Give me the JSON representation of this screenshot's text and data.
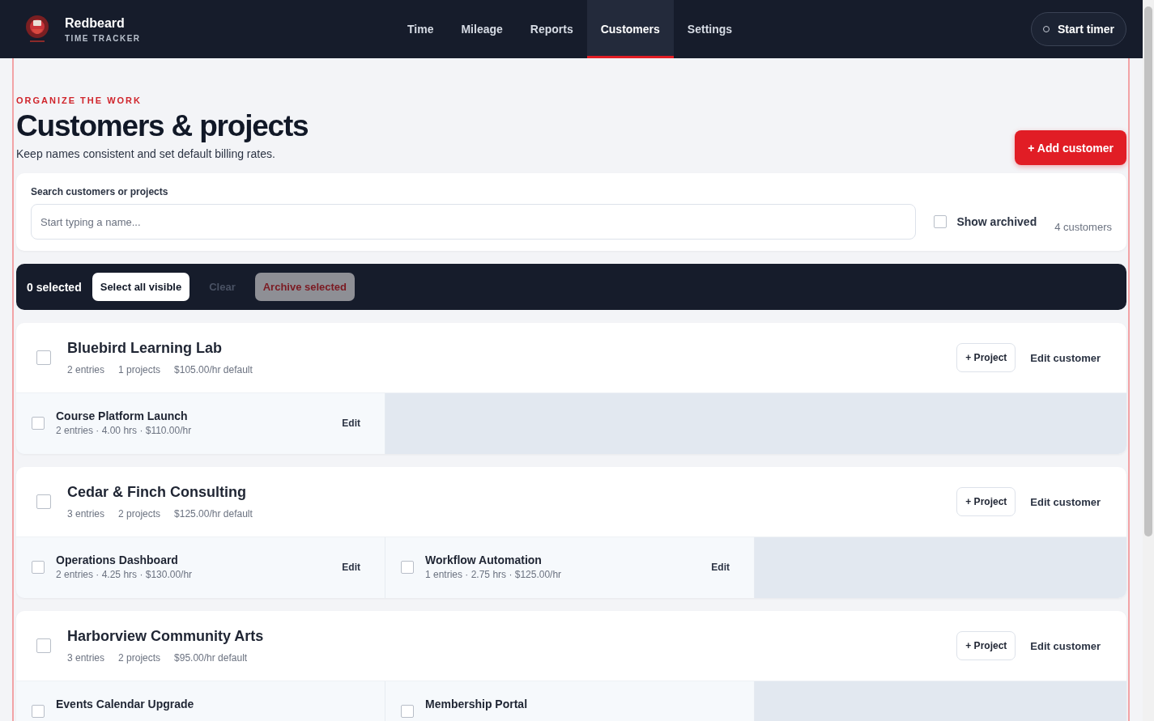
{
  "nav": {
    "brand": "Redbeard",
    "tagline": "TIME TRACKER",
    "tabs": [
      {
        "label": "Time",
        "selected": false
      },
      {
        "label": "Mileage",
        "selected": false
      },
      {
        "label": "Reports",
        "selected": false
      },
      {
        "label": "Customers",
        "selected": true
      },
      {
        "label": "Settings",
        "selected": false
      }
    ],
    "timer_button": "Start timer"
  },
  "header": {
    "eyebrow": "ORGANIZE THE WORK",
    "title": "Customers & projects",
    "subtitle": "Keep names consistent and set default billing rates.",
    "add_button": "+ Add customer"
  },
  "search": {
    "label": "Search customers or projects",
    "placeholder": "Start typing a name...",
    "show_archived": {
      "label": "Show archived",
      "checked": false
    },
    "count": "4 customers"
  },
  "bulk_bar": {
    "selected_count": "0 selected",
    "buttons": [
      {
        "label": "Select all visible",
        "kind": "light",
        "disabled": false
      },
      {
        "label": "Clear",
        "kind": "plain",
        "disabled": true
      },
      {
        "label": "Archive selected",
        "kind": "danger",
        "disabled": true
      }
    ]
  },
  "customers": [
    {
      "name": "Bluebird Learning Lab",
      "checked": false,
      "meta": [
        "2 entries",
        "1 projects",
        "$105.00/hr default"
      ],
      "project_button": "+ Project",
      "edit_button": "Edit customer",
      "projects": [
        {
          "name": "Course Platform Launch",
          "checked": false,
          "meta": "2 entries · 4.00 hrs · $110.00/hr",
          "edit": "Edit"
        }
      ]
    },
    {
      "name": "Cedar & Finch Consulting",
      "checked": false,
      "meta": [
        "3 entries",
        "2 projects",
        "$125.00/hr default"
      ],
      "project_button": "+ Project",
      "edit_button": "Edit customer",
      "projects": [
        {
          "name": "Operations Dashboard",
          "checked": false,
          "meta": "2 entries · 4.25 hrs · $130.00/hr",
          "edit": "Edit"
        },
        {
          "name": "Workflow Automation",
          "checked": false,
          "meta": "1 entries · 2.75 hrs · $125.00/hr",
          "edit": "Edit"
        }
      ]
    },
    {
      "name": "Harborview Community Arts",
      "checked": false,
      "meta": [
        "3 entries",
        "2 projects",
        "$95.00/hr default"
      ],
      "project_button": "+ Project",
      "edit_button": "Edit customer",
      "projects": [
        {
          "name": "Events Calendar Upgrade",
          "checked": false
        },
        {
          "name": "Membership Portal",
          "checked": false
        }
      ]
    }
  ]
}
